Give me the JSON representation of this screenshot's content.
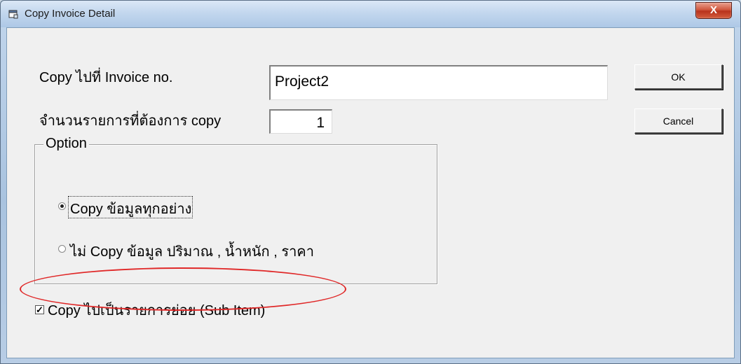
{
  "window": {
    "title": "Copy Invoice Detail",
    "close_label": "X"
  },
  "form": {
    "invoice_label": "Copy ไปที่ Invoice no.",
    "invoice_value": "Project2",
    "count_label": "จำนวนรายการที่ต้องการ copy",
    "count_value": "1",
    "ok_label": "OK",
    "cancel_label": "Cancel"
  },
  "option_group": {
    "legend": "Option",
    "options": [
      {
        "label": "Copy ข้อมูลทุกอย่าง",
        "selected": true
      },
      {
        "label": "ไม่ Copy ข้อมูล ปริมาณ , น้ำหนัก , ราคา",
        "selected": false
      }
    ]
  },
  "sub_item": {
    "label": "Copy ไปเป็นรายการย่อย (Sub Item)",
    "checked": true,
    "check_glyph": "✓"
  },
  "colors": {
    "highlight": "#e02828",
    "dialog_bg": "#f0f0f0"
  }
}
